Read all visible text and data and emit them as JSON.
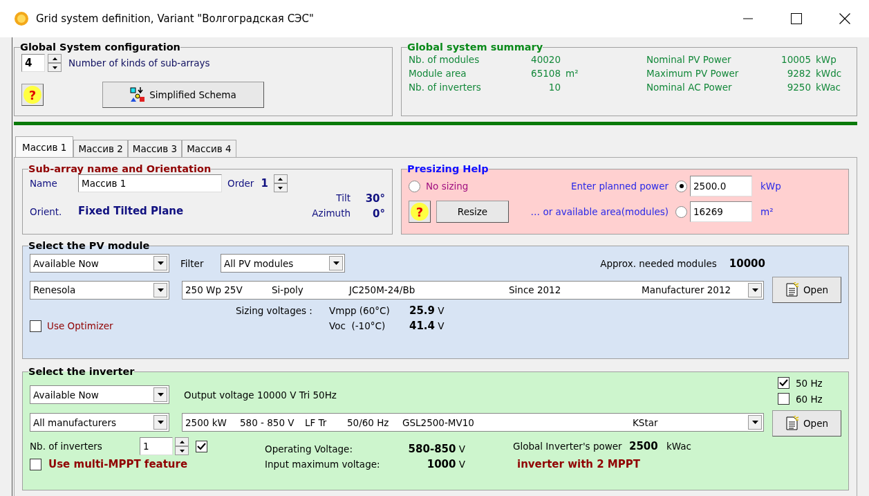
{
  "window": {
    "title": "Grid system definition, Variant  \"Волгоградская СЭС\""
  },
  "global_config": {
    "title": "Global System configuration",
    "kinds_count": "4",
    "kinds_label": "Number of kinds of sub-arrays",
    "help_button": "?",
    "schema_button": "Simplified Schema"
  },
  "summary": {
    "title": "Global system summary",
    "items": [
      {
        "label": "Nb. of modules",
        "value": "40020"
      },
      {
        "label": "Nominal PV Power",
        "value": "10005",
        "unit": "kWp"
      },
      {
        "label": "Module area",
        "value": "65108",
        "unit": "m²"
      },
      {
        "label": "Maximum PV Power",
        "value": "9282",
        "unit": "kWdc"
      },
      {
        "label": "Nb. of inverters",
        "value": "10"
      },
      {
        "label": "Nominal AC Power",
        "value": "9250",
        "unit": "kWac"
      }
    ]
  },
  "tabs": [
    {
      "label": "Массив 1",
      "selected": true
    },
    {
      "label": "Массив 2",
      "selected": false
    },
    {
      "label": "Массив 3",
      "selected": false
    },
    {
      "label": "Массив 4",
      "selected": false
    }
  ],
  "sub_array": {
    "title": "Sub-array name and Orientation",
    "name_label": "Name",
    "name_value": "Массив 1",
    "order_label": "Order",
    "order_value": "1",
    "orient_label": "Orient.",
    "orient_value": "Fixed Tilted Plane",
    "tilt_label": "Tilt",
    "tilt_value": "30°",
    "azimuth_label": "Azimuth",
    "azimuth_value": "0°"
  },
  "presizing": {
    "title": "Presizing Help",
    "help_button": "?",
    "resize_button": "Resize",
    "options": [
      {
        "label": "No sizing",
        "selected": false
      },
      {
        "label": "Enter planned power",
        "selected": true,
        "value": "2500.0",
        "unit": "kWp"
      },
      {
        "label": "… or available area(modules)",
        "selected": false,
        "value": "16269",
        "unit": "m²"
      }
    ]
  },
  "pv_module": {
    "title": "Select the PV module",
    "availability": "Available Now",
    "filter_label": "Filter",
    "filter_value": "All PV modules",
    "needed_label": "Approx. needed modules",
    "needed_value": "10000",
    "manufacturer": "Renesola",
    "model_fields": [
      "250 Wp 25V",
      "Si-poly",
      "JC250M-24/Bb",
      "Since 2012",
      "Manufacturer 2012"
    ],
    "open_button": "Open",
    "sizing_label": "Sizing voltages :",
    "voltages": [
      {
        "label": "Vmpp (60°C)",
        "value": "25.9",
        "unit": "V"
      },
      {
        "label": "Voc  (-10°C)",
        "value": "41.4",
        "unit": "V"
      }
    ],
    "optimizer": {
      "label": "Use Optimizer",
      "checked": false
    }
  },
  "inverter": {
    "title": "Select the inverter",
    "availability": "Available Now",
    "output_voltage": "Output voltage 10000 V Tri 50Hz",
    "frequencies": [
      {
        "label": "50 Hz",
        "checked": true
      },
      {
        "label": "60 Hz",
        "checked": false
      }
    ],
    "manufacturer": "All manufacturers",
    "model_fields": [
      "2500 kW",
      "580 - 850 V",
      "LF Tr",
      "50/60 Hz",
      "GSL2500-MV10",
      "KStar"
    ],
    "open_button": "Open",
    "count_label": "Nb. of inverters",
    "count_value": "1",
    "count_checked": true,
    "multi_mppt": {
      "label": "Use multi-MPPT feature",
      "checked": false
    },
    "operating_label": "Operating Voltage:",
    "operating_value": "580-850",
    "operating_unit": "V",
    "max_label": "Input maximum voltage:",
    "max_value": "1000",
    "max_unit": "V",
    "power_label": "Global Inverter's power",
    "power_value": "2500",
    "power_unit": "kWac",
    "mppt_note": "inverter with 2 MPPT"
  }
}
